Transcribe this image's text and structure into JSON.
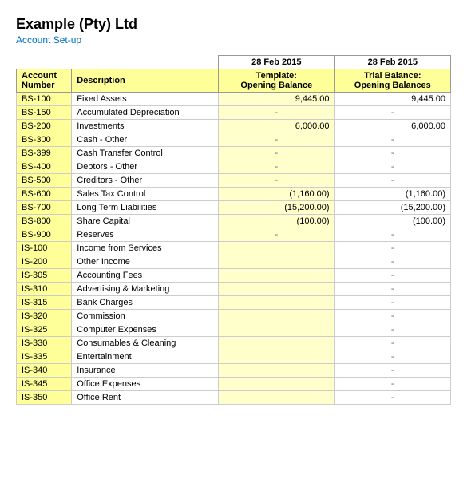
{
  "company": {
    "name": "Example (Pty) Ltd",
    "subtitle": "Account Set-up"
  },
  "columns": {
    "account": "Account Number",
    "description": "Description",
    "template_date": "28 Feb 2015",
    "template_label": "Template:",
    "template_sublabel": "Opening Balance",
    "trial_date": "28 Feb 2015",
    "trial_label": "Trial Balance:",
    "trial_sublabel": "Opening Balances"
  },
  "rows": [
    {
      "account": "BS-100",
      "description": "Fixed Assets",
      "template": "9,445.00",
      "trial": "9,445.00",
      "t_type": "value",
      "tr_type": "value"
    },
    {
      "account": "BS-150",
      "description": "Accumulated Depreciation",
      "template": "-",
      "trial": "-",
      "t_type": "dash",
      "tr_type": "dash"
    },
    {
      "account": "BS-200",
      "description": "Investments",
      "template": "6,000.00",
      "trial": "6,000.00",
      "t_type": "value",
      "tr_type": "value"
    },
    {
      "account": "BS-300",
      "description": "Cash - Other",
      "template": "-",
      "trial": "-",
      "t_type": "dash",
      "tr_type": "dash"
    },
    {
      "account": "BS-399",
      "description": "Cash Transfer Control",
      "template": "-",
      "trial": "-",
      "t_type": "dash",
      "tr_type": "dash"
    },
    {
      "account": "BS-400",
      "description": "Debtors - Other",
      "template": "-",
      "trial": "-",
      "t_type": "dash",
      "tr_type": "dash"
    },
    {
      "account": "BS-500",
      "description": "Creditors - Other",
      "template": "-",
      "trial": "-",
      "t_type": "dash",
      "tr_type": "dash"
    },
    {
      "account": "BS-600",
      "description": "Sales Tax Control",
      "template": "(1,160.00)",
      "trial": "(1,160.00)",
      "t_type": "negative",
      "tr_type": "negative"
    },
    {
      "account": "BS-700",
      "description": "Long Term Liabilities",
      "template": "(15,200.00)",
      "trial": "(15,200.00)",
      "t_type": "negative",
      "tr_type": "negative"
    },
    {
      "account": "BS-800",
      "description": "Share Capital",
      "template": "(100.00)",
      "trial": "(100.00)",
      "t_type": "negative",
      "tr_type": "negative"
    },
    {
      "account": "BS-900",
      "description": "Reserves",
      "template": "-",
      "trial": "-",
      "t_type": "dash",
      "tr_type": "dash"
    },
    {
      "account": "IS-100",
      "description": "Income from Services",
      "template": "",
      "trial": "-",
      "t_type": "empty",
      "tr_type": "dash"
    },
    {
      "account": "IS-200",
      "description": "Other Income",
      "template": "",
      "trial": "-",
      "t_type": "empty",
      "tr_type": "dash"
    },
    {
      "account": "IS-305",
      "description": "Accounting Fees",
      "template": "",
      "trial": "-",
      "t_type": "empty",
      "tr_type": "dash"
    },
    {
      "account": "IS-310",
      "description": "Advertising & Marketing",
      "template": "",
      "trial": "-",
      "t_type": "empty",
      "tr_type": "dash"
    },
    {
      "account": "IS-315",
      "description": "Bank Charges",
      "template": "",
      "trial": "-",
      "t_type": "empty",
      "tr_type": "dash"
    },
    {
      "account": "IS-320",
      "description": "Commission",
      "template": "",
      "trial": "-",
      "t_type": "empty",
      "tr_type": "dash"
    },
    {
      "account": "IS-325",
      "description": "Computer Expenses",
      "template": "",
      "trial": "-",
      "t_type": "empty",
      "tr_type": "dash"
    },
    {
      "account": "IS-330",
      "description": "Consumables & Cleaning",
      "template": "",
      "trial": "-",
      "t_type": "empty",
      "tr_type": "dash"
    },
    {
      "account": "IS-335",
      "description": "Entertainment",
      "template": "",
      "trial": "-",
      "t_type": "empty",
      "tr_type": "dash"
    },
    {
      "account": "IS-340",
      "description": "Insurance",
      "template": "",
      "trial": "-",
      "t_type": "empty",
      "tr_type": "dash"
    },
    {
      "account": "IS-345",
      "description": "Office Expenses",
      "template": "",
      "trial": "-",
      "t_type": "empty",
      "tr_type": "dash"
    },
    {
      "account": "IS-350",
      "description": "Office Rent",
      "template": "",
      "trial": "-",
      "t_type": "empty",
      "tr_type": "dash"
    }
  ]
}
